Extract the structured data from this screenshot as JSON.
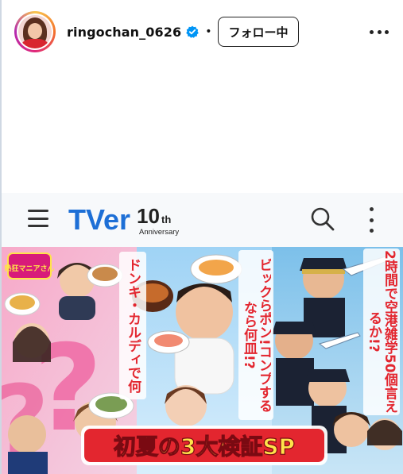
{
  "post": {
    "username": "ringochan_0626",
    "separator": "•",
    "follow_label": "フォロー中"
  },
  "colors": {
    "verified": "#0095f6",
    "tver_blue": "#1d6fd6",
    "banner_title_red": "#e3262f",
    "banner_title_yellow": "#ffe34a"
  },
  "icons": {
    "menu": "hamburger-icon",
    "search": "search-icon",
    "more": "kebab-icon"
  },
  "tver": {
    "brand": "TVer",
    "anniversary_number": "10",
    "anniversary_suffix": "th",
    "anniversary_word": "Anniversary"
  },
  "banner": {
    "title": "初夏の3大検証SP",
    "left_caption": "ドンキ・カルディで何kg痩せる?",
    "middle_caption": "ビックらポン!コンプするなら何皿!?",
    "right_caption": "2時間で空港雑学50個言えるか!?",
    "logo_badge": "熱狂マニアさん"
  }
}
